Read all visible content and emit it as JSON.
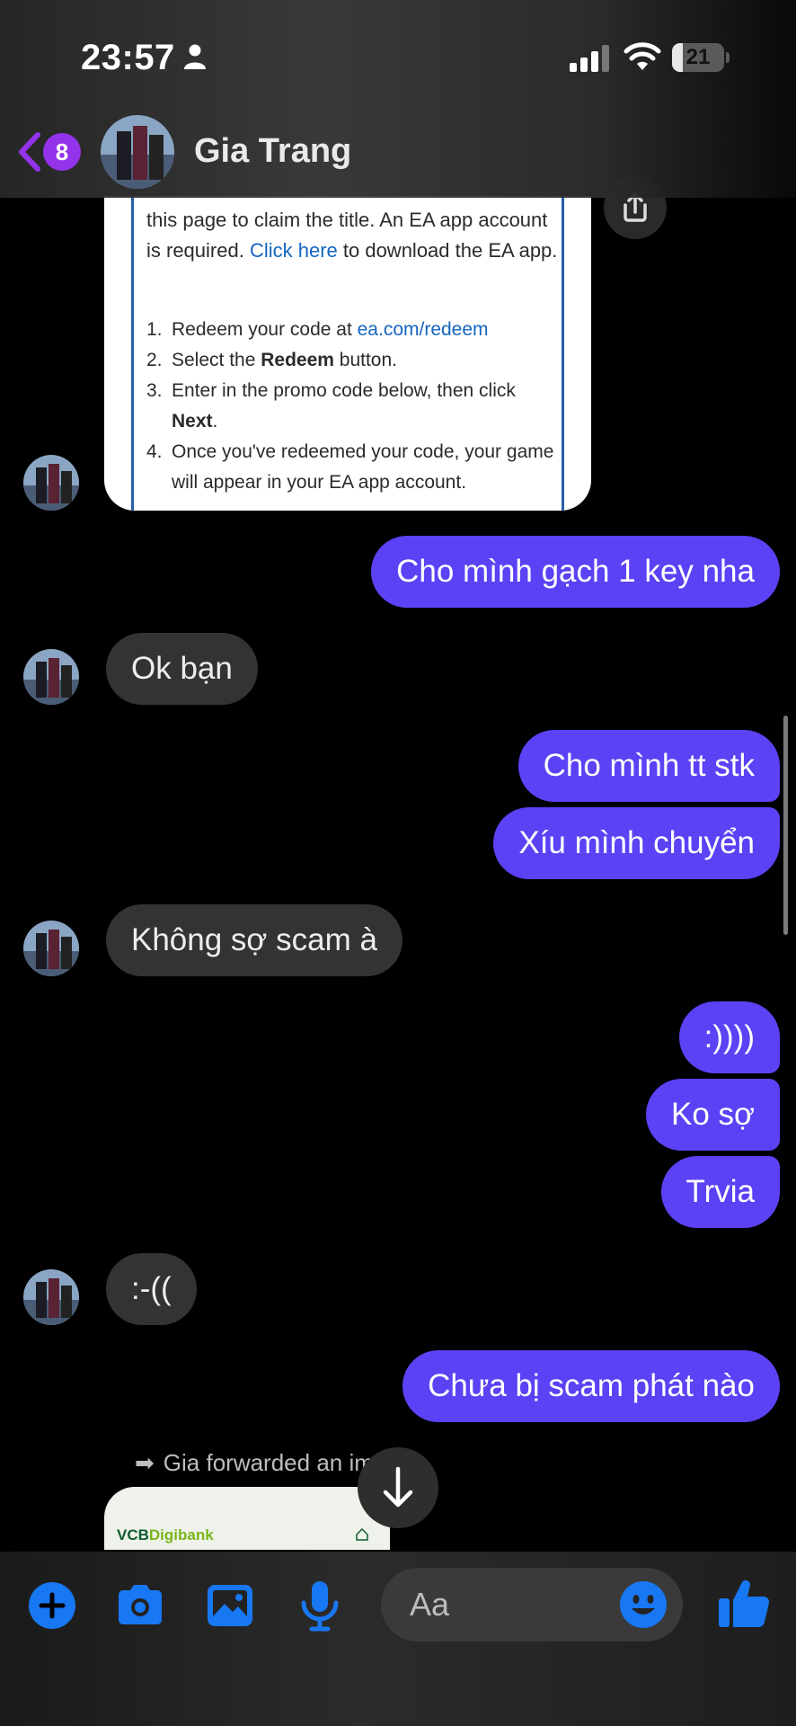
{
  "status_bar": {
    "time": "23:57",
    "battery": "21",
    "battery_level": 0.21
  },
  "header": {
    "unread_count": "8",
    "contact_name": "Gia Trang"
  },
  "shared_image": {
    "intro_parts": [
      "this page to claim the title. An EA app account is required. ",
      "Click here",
      " to download the EA app."
    ],
    "steps": [
      {
        "num": "1.",
        "parts": [
          "Redeem your code at ",
          "ea.com/redeem"
        ]
      },
      {
        "num": "2.",
        "parts": [
          "Select the ",
          "Redeem",
          " button."
        ]
      },
      {
        "num": "3.",
        "parts": [
          "Enter in the promo code below, then click ",
          "Next",
          "."
        ]
      },
      {
        "num": "4.",
        "parts": [
          "Once you've redeemed your code, your game will appear in your EA app account."
        ]
      }
    ]
  },
  "messages": [
    {
      "id": "m1",
      "dir": "out",
      "text": "Cho mình gạch 1 key nha"
    },
    {
      "id": "m2",
      "dir": "in",
      "text": "Ok bạn"
    },
    {
      "id": "m3",
      "dir": "out",
      "text": "Cho mình tt stk"
    },
    {
      "id": "m4",
      "dir": "out",
      "text": "Xíu mình chuyển"
    },
    {
      "id": "m5",
      "dir": "in",
      "text": "Không sợ scam à"
    },
    {
      "id": "m6",
      "dir": "out",
      "text": ":))))"
    },
    {
      "id": "m7",
      "dir": "out",
      "text": "Ko sợ"
    },
    {
      "id": "m8",
      "dir": "out",
      "text": "Trvia"
    },
    {
      "id": "m9",
      "dir": "in",
      "text": ":-(("
    },
    {
      "id": "m10",
      "dir": "out",
      "text": "Chưa bị scam phát nào"
    }
  ],
  "forward_note": "Gia forwarded an image",
  "forwarded_image": {
    "logo_a": "VCB",
    "logo_b": "Digibank"
  },
  "composer": {
    "placeholder": "Aa"
  },
  "colors": {
    "outgoing": "#5b42f5",
    "incoming": "#333333",
    "accent": "#1877f2",
    "badge": "#9333ea"
  },
  "icons": [
    "person-icon",
    "signal-icon",
    "wifi-icon",
    "back-chevron-icon",
    "share-icon",
    "arrow-down-icon",
    "plus-icon",
    "camera-icon",
    "gallery-icon",
    "microphone-icon",
    "emoji-icon",
    "like-icon"
  ]
}
